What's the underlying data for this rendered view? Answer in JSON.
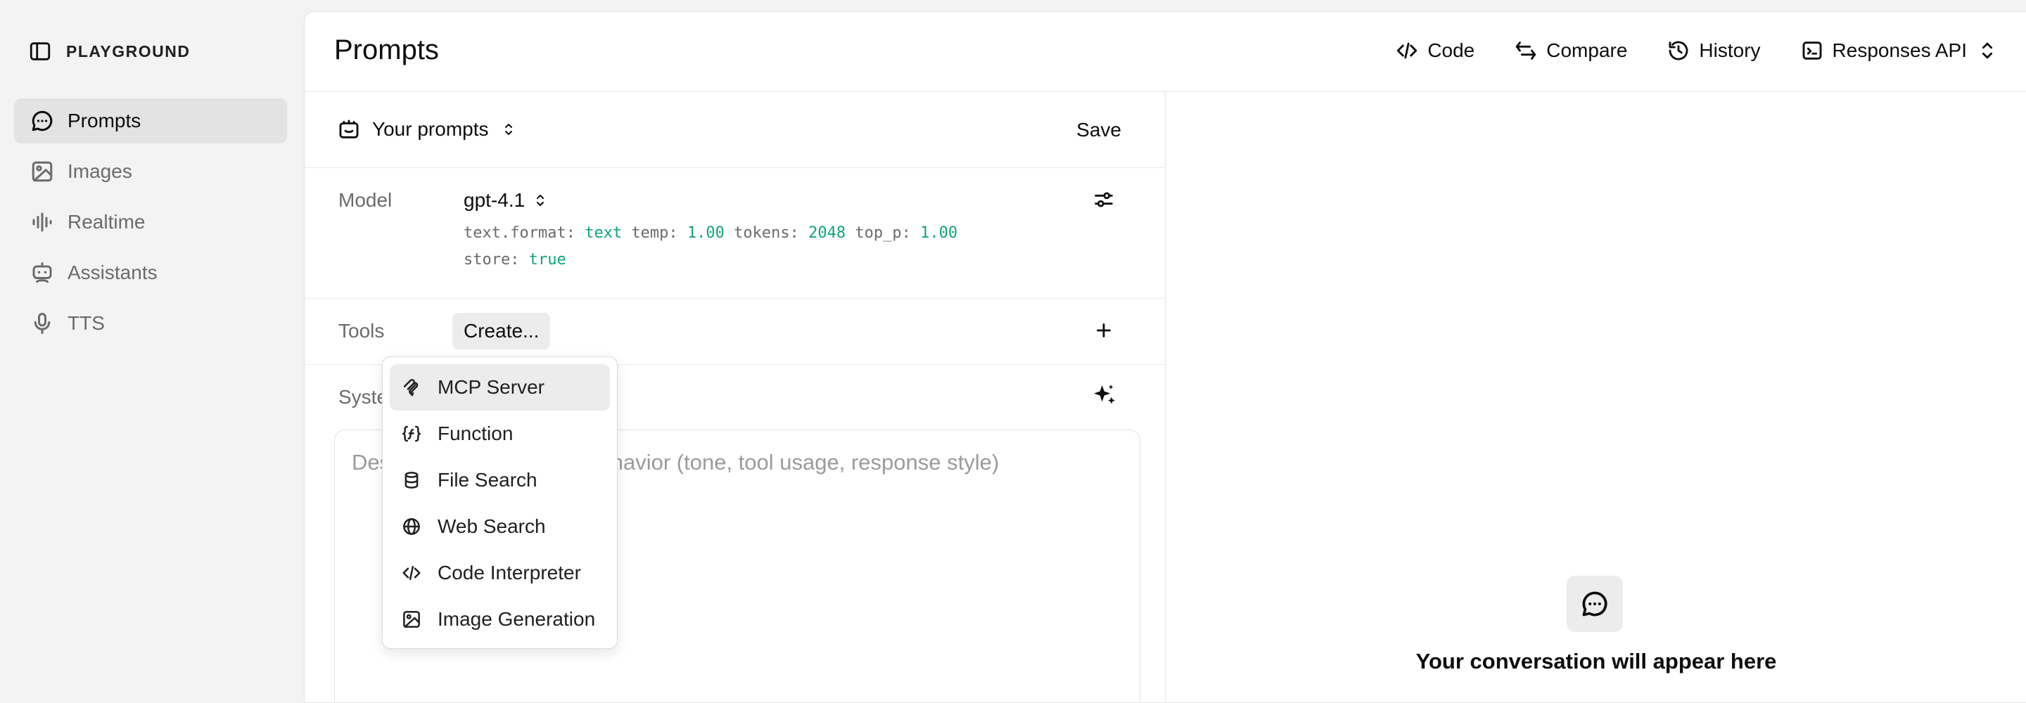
{
  "sidebar": {
    "brand": "PLAYGROUND",
    "items": [
      {
        "label": "Prompts",
        "icon": "chat-bubble-icon",
        "active": true
      },
      {
        "label": "Images",
        "icon": "image-icon",
        "active": false
      },
      {
        "label": "Realtime",
        "icon": "waveform-icon",
        "active": false
      },
      {
        "label": "Assistants",
        "icon": "robot-icon",
        "active": false
      },
      {
        "label": "TTS",
        "icon": "microphone-icon",
        "active": false
      }
    ]
  },
  "header": {
    "title": "Prompts",
    "actions": {
      "code": "Code",
      "compare": "Compare",
      "history": "History",
      "api": "Responses API"
    }
  },
  "prompt_bar": {
    "selector_label": "Your prompts",
    "save_label": "Save"
  },
  "model": {
    "label": "Model",
    "name": "gpt-4.1",
    "params": {
      "text_format_key": "text.format:",
      "text_format_val": "text",
      "temp_key": "temp:",
      "temp_val": "1.00",
      "tokens_key": "tokens:",
      "tokens_val": "2048",
      "top_p_key": "top_p:",
      "top_p_val": "1.00",
      "store_key": "store:",
      "store_val": "true"
    }
  },
  "tools": {
    "label": "Tools",
    "create_label": "Create..."
  },
  "system": {
    "label": "System message",
    "placeholder": "Describe desired model behavior (tone, tool usage, response style)"
  },
  "tool_menu": {
    "items": [
      {
        "label": "MCP Server",
        "icon": "mcp-icon",
        "highlighted": true
      },
      {
        "label": "Function",
        "icon": "function-braces-icon",
        "highlighted": false
      },
      {
        "label": "File Search",
        "icon": "database-icon",
        "highlighted": false
      },
      {
        "label": "Web Search",
        "icon": "globe-icon",
        "highlighted": false
      },
      {
        "label": "Code Interpreter",
        "icon": "code-icon",
        "highlighted": false
      },
      {
        "label": "Image Generation",
        "icon": "image-icon",
        "highlighted": false
      }
    ]
  },
  "conversation": {
    "empty_text": "Your conversation will appear here"
  },
  "colors": {
    "accent_green": "#10a37f",
    "active_bg": "#e3e3e3",
    "sidebar_bg": "#f3f3f3"
  }
}
